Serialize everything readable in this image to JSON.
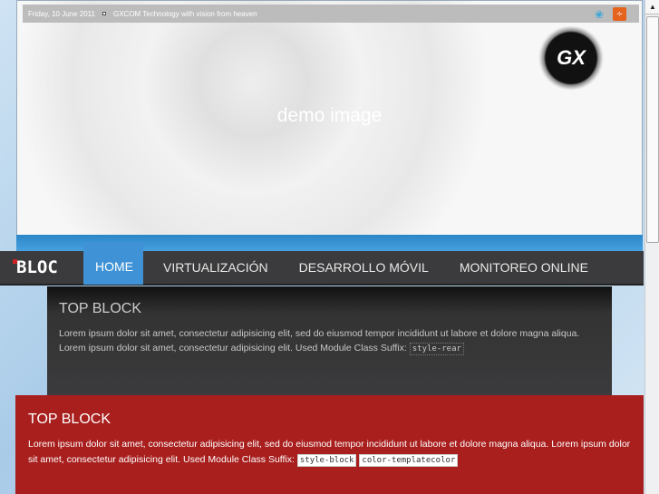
{
  "topbar": {
    "date": "Friday, 10 June 2011",
    "tagline": "GXCOM Technology with vision from heaven"
  },
  "header": {
    "demo_text": "demo image",
    "logo_text": "GX"
  },
  "nav": {
    "brand": "BLOC",
    "items": [
      "HOME",
      "VIRTUALIZACIÓN",
      "DESARROLLO MÓVIL",
      "MONITOREO ONLINE"
    ]
  },
  "rear_block": {
    "title": "TOP BLOCK",
    "text1": "Lorem ipsum dolor sit amet, consectetur adipisicing elit, sed do eiusmod tempor incididunt ut labore et dolore magna aliqua.",
    "text2": "Lorem ipsum dolor sit amet, consectetur adipisicing elit. Used Module Class Suffix:",
    "code": "style-rear"
  },
  "red_block": {
    "title": "TOP BLOCK",
    "text": "Lorem ipsum dolor sit amet, consectetur adipisicing elit, sed do eiusmod tempor incididunt ut labore et dolore magna aliqua. Lorem ipsum dolor sit amet, consectetur adipisicing elit. Used Module Class Suffix:",
    "code1": "style-block",
    "code2": "color-templatecolor"
  },
  "colors": {
    "accent": "#3f92d6",
    "red": "#a81f1e",
    "nav": "#3b3b3d"
  }
}
